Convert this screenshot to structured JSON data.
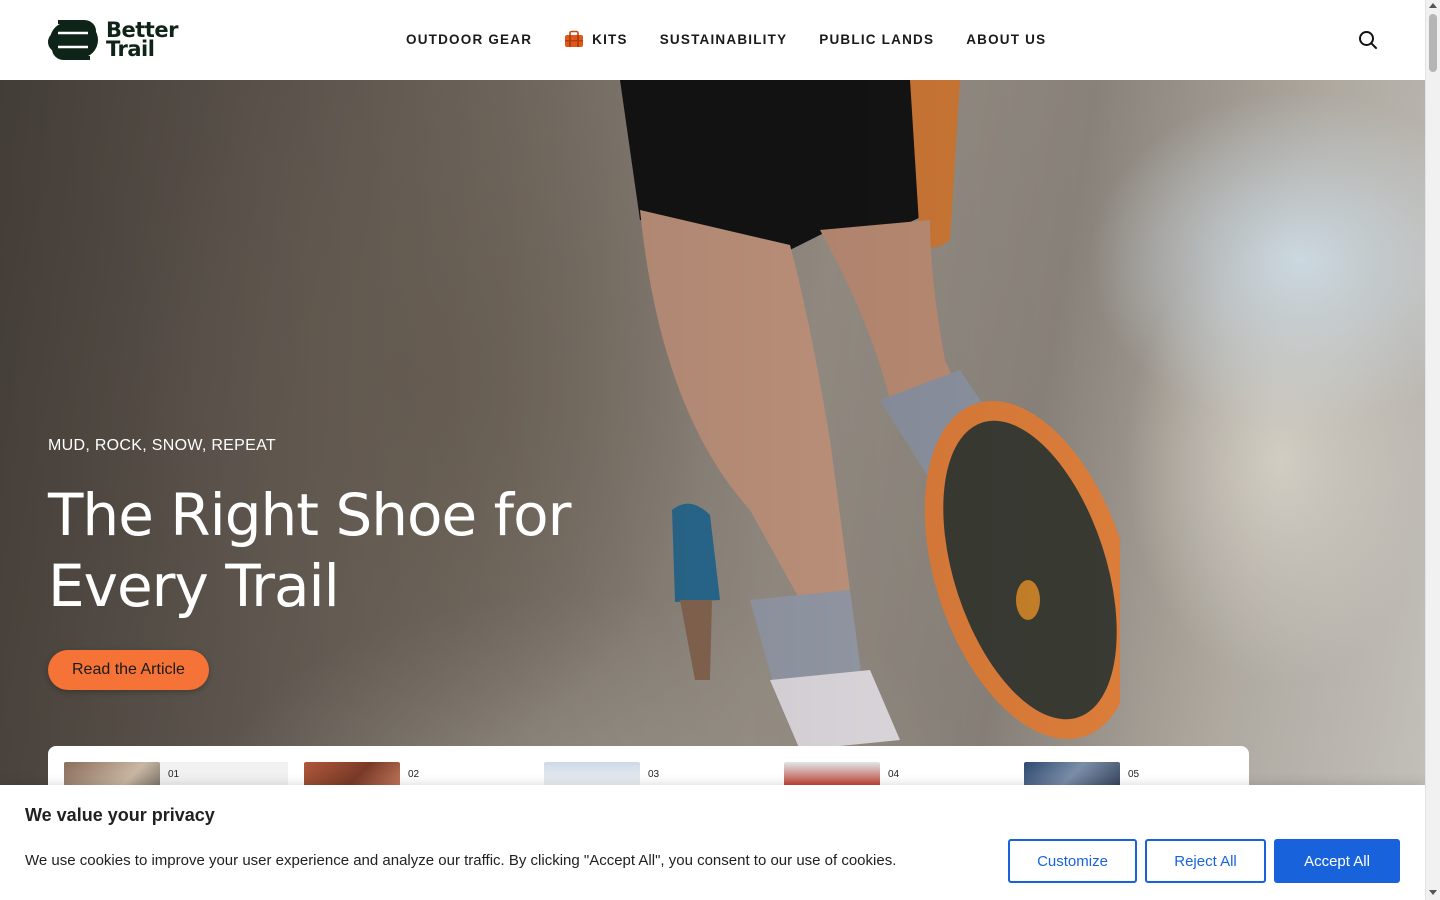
{
  "brand": {
    "line1": "Better",
    "line2": "Trail",
    "color": "#0f2418"
  },
  "nav": {
    "items": [
      {
        "label": "OUTDOOR GEAR"
      },
      {
        "label": "KITS",
        "icon": "duffel-bag-icon"
      },
      {
        "label": "SUSTAINABILITY"
      },
      {
        "label": "PUBLIC LANDS"
      },
      {
        "label": "ABOUT US"
      }
    ],
    "search_icon": "search-icon"
  },
  "hero": {
    "eyebrow": "MUD, ROCK, SNOW, REPEAT",
    "title": "The Right Shoe for Every Trail",
    "cta_label": "Read the Article",
    "cta_color": "#f57336"
  },
  "articles": {
    "items": [
      {
        "number": "01"
      },
      {
        "number": "02"
      },
      {
        "number": "03"
      },
      {
        "number": "04"
      },
      {
        "number": "05"
      }
    ]
  },
  "cookie_banner": {
    "title": "We value your privacy",
    "text": "We use cookies to improve your user experience and analyze our traffic. By clicking \"Accept All\", you consent to our use of cookies.",
    "customize_label": "Customize",
    "reject_label": "Reject All",
    "accept_label": "Accept All",
    "accent_color": "#1863dc"
  }
}
